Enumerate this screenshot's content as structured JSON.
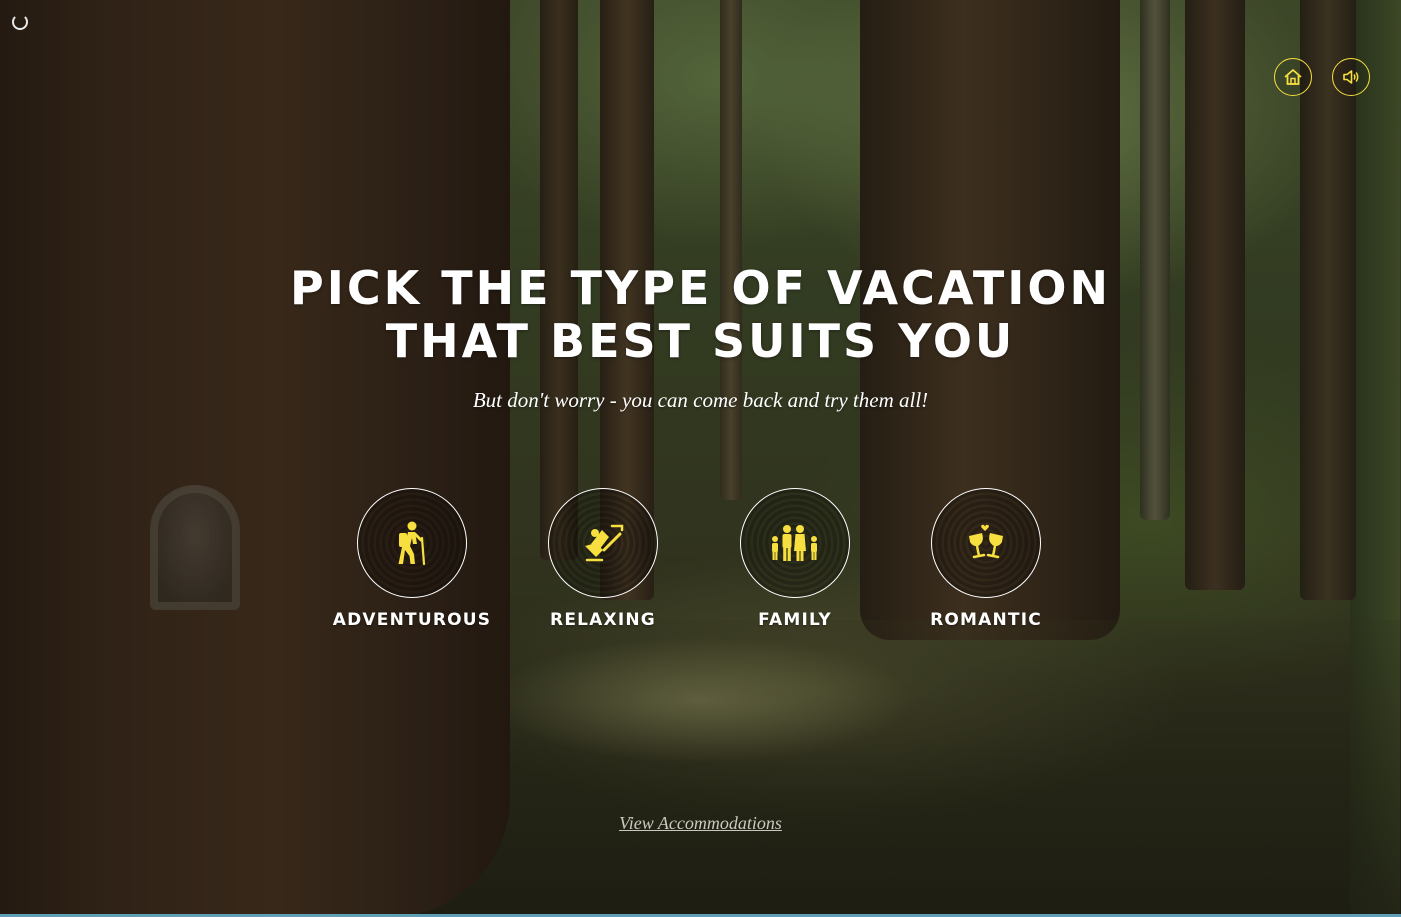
{
  "headline": {
    "line1": "PICK THE TYPE OF VACATION",
    "line2": "THAT BEST SUITS YOU"
  },
  "subtitle": "But don't worry - you can come back and try them all!",
  "top_controls": {
    "home_icon": "home-icon",
    "sound_icon": "speaker-icon"
  },
  "options": [
    {
      "label": "ADVENTUROUS",
      "icon": "hiker-icon"
    },
    {
      "label": "RELAXING",
      "icon": "reclining-chair-icon"
    },
    {
      "label": "FAMILY",
      "icon": "family-icon"
    },
    {
      "label": "ROMANTIC",
      "icon": "wine-glasses-icon"
    }
  ],
  "footer_link": "View Accommodations",
  "colors": {
    "accent_yellow": "#f6df3e",
    "text_white": "#ffffff",
    "link_gray": "#c9c9bf"
  }
}
